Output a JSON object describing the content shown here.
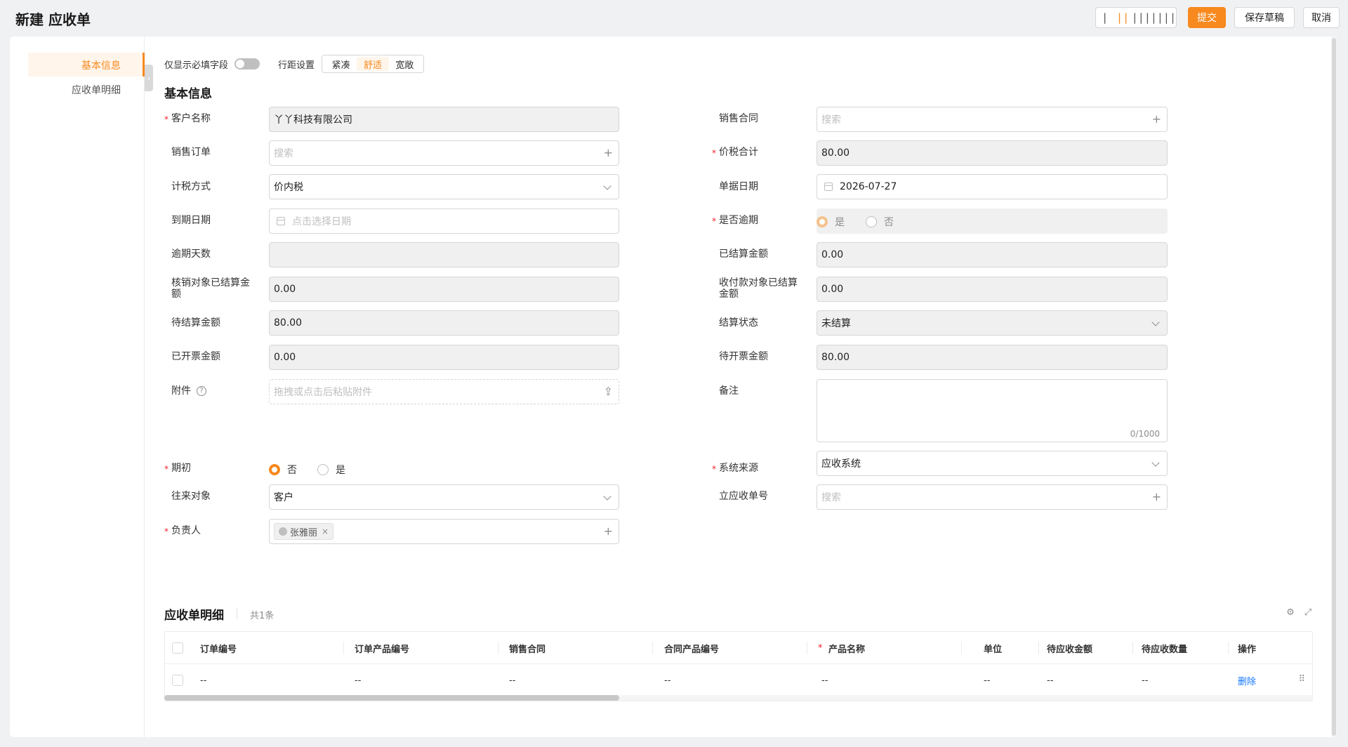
{
  "header": {
    "title": "新建 应收单",
    "column_options": [
      "Ⅰ",
      "Ⅱ",
      "Ⅲ",
      "Ⅳ"
    ],
    "column_options_text": [
      "|",
      "||",
      "|||",
      "||||"
    ],
    "submit": "提交",
    "save_draft": "保存草稿",
    "cancel": "取消"
  },
  "nav": {
    "items": [
      "基本信息",
      "应收单明细"
    ],
    "collapse_icon": "‹"
  },
  "toolbar": {
    "required_only_label": "仅显示必填字段",
    "row_spacing_label": "行距设置",
    "density_options": [
      "紧凑",
      "舒适",
      "宽敞"
    ],
    "density_selected": "舒适"
  },
  "basic": {
    "section_title": "基本信息",
    "customer_name": {
      "label": "客户名称",
      "value": "丫丫科技有限公司"
    },
    "sales_contract": {
      "label": "销售合同",
      "placeholder": "搜索"
    },
    "sales_order": {
      "label": "销售订单",
      "placeholder": "搜索"
    },
    "total_with_tax": {
      "label": "价税合计",
      "value": "80.00"
    },
    "tax_method": {
      "label": "计税方式",
      "value": "价内税"
    },
    "doc_date": {
      "label": "单据日期",
      "value": "2026-07-27"
    },
    "due_date": {
      "label": "到期日期",
      "placeholder": "点击选择日期"
    },
    "is_overdue": {
      "label": "是否逾期",
      "options": [
        "是",
        "否"
      ],
      "selected": "是"
    },
    "overdue_days": {
      "label": "逾期天数",
      "value": ""
    },
    "settled_amount": {
      "label": "已结算金额",
      "value": "0.00"
    },
    "writeoff_settled": {
      "label_line1": "核销对象已结算金",
      "label_line2": "额",
      "value": "0.00"
    },
    "payment_settled": {
      "label_line1": "收付款对象已结算",
      "label_line2": "金额",
      "value": "0.00"
    },
    "pending_settle": {
      "label": "待结算金额",
      "value": "80.00"
    },
    "settle_status": {
      "label": "结算状态",
      "value": "未结算"
    },
    "invoiced_amount": {
      "label": "已开票金额",
      "value": "0.00"
    },
    "pending_invoice": {
      "label": "待开票金额",
      "value": "80.00"
    },
    "attachment": {
      "label": "附件",
      "placeholder": "拖拽或点击后粘贴附件"
    },
    "remark": {
      "label": "备注",
      "count": "0/1000"
    },
    "opening": {
      "label": "期初",
      "options": [
        "否",
        "是"
      ],
      "selected": "否"
    },
    "system_source": {
      "label": "系统来源",
      "value": "应收系统"
    },
    "counterparty": {
      "label": "往来对象",
      "value": "客户"
    },
    "receivable_no": {
      "label": "立应收单号",
      "placeholder": "搜索"
    },
    "owner": {
      "label": "负责人",
      "tag": "张雅丽",
      "remove": "×"
    },
    "plus_icon": "+",
    "help_icon": "?",
    "upload_icon": "⇪",
    "required_mark": "*"
  },
  "detail": {
    "section_title": "应收单明细",
    "count_text": "共1条",
    "columns": [
      "订单编号",
      "订单产品编号",
      "销售合同",
      "合同产品编号",
      "产品名称",
      "单位",
      "待应收金额",
      "待应收数量",
      "操作"
    ],
    "rows": [
      {
        "order_no": "--",
        "order_product_no": "--",
        "sales_contract": "--",
        "contract_product_no": "--",
        "product_name": "--",
        "unit": "--",
        "pending_amount": "--",
        "pending_qty": "--",
        "action": "删除"
      }
    ],
    "settings_icon": "⚙",
    "fullscreen_icon": "⤢",
    "drag_icon": "⠿"
  },
  "colors": {
    "accent": "#f7891e",
    "link": "#1677ff",
    "required": "#f5222d"
  }
}
